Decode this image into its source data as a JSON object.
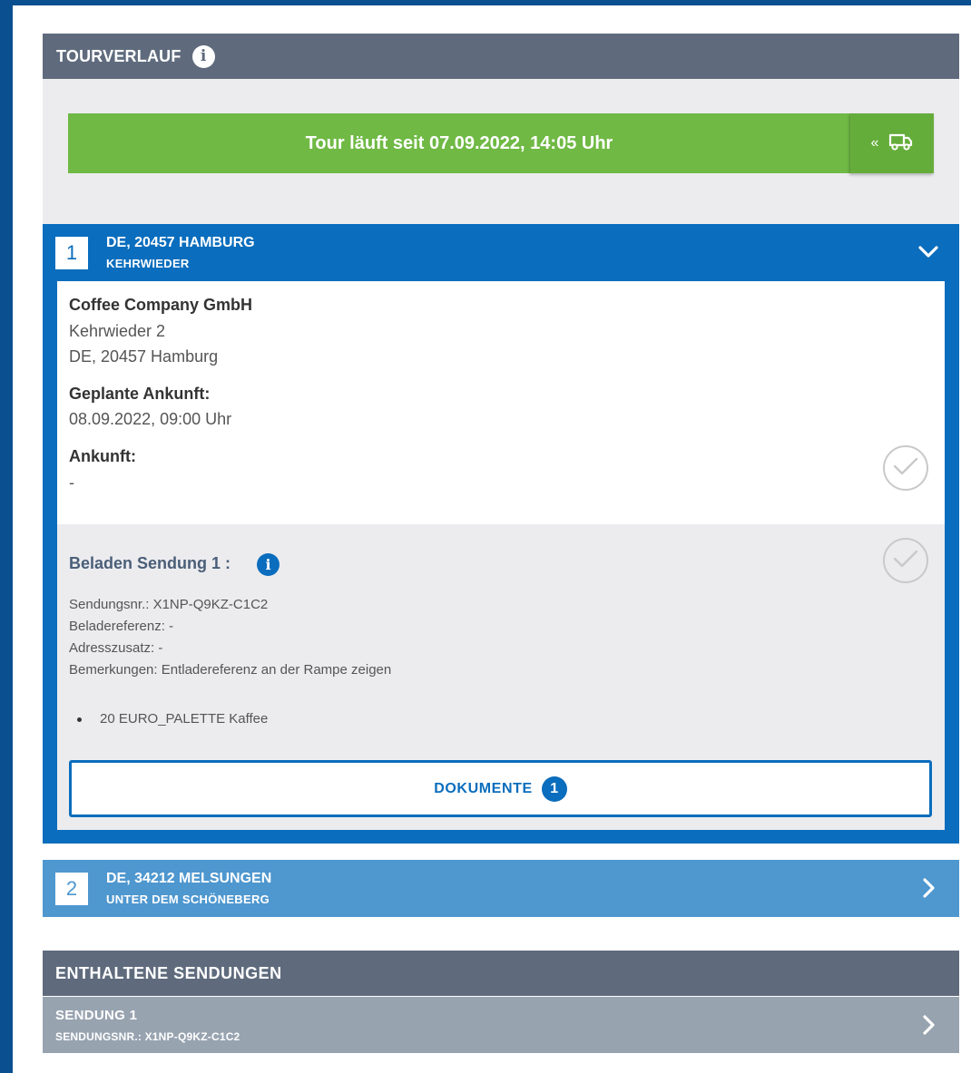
{
  "tour_panel": {
    "title": "TOURVERLAUF",
    "info_glyph": "i",
    "status_text": "Tour läuft seit 07.09.2022, 14:05 Uhr",
    "action_chevron": "«",
    "action_icon": "truck-icon"
  },
  "stops": [
    {
      "number": "1",
      "line1": "DE, 20457 HAMBURG",
      "line2": "KEHRWIEDER",
      "expanded": true,
      "company": "Coffee Company GmbH",
      "street": "Kehrwieder 2",
      "city": "DE, 20457 Hamburg",
      "planned_label": "Geplante Ankunft:",
      "planned_value": "08.09.2022, 09:00 Uhr",
      "arrival_label": "Ankunft:",
      "arrival_value": "-",
      "shipment": {
        "title": "Beladen Sendung 1 :",
        "info_glyph": "i",
        "details": [
          "Sendungsnr.: X1NP-Q9KZ-C1C2",
          "Beladereferenz: -",
          "Adresszusatz: -",
          "Bemerkungen: Entladereferenz an der Rampe zeigen"
        ],
        "items": [
          "20 EURO_PALETTE Kaffee"
        ],
        "documents_label": "DOKUMENTE",
        "documents_count": "1"
      }
    },
    {
      "number": "2",
      "line1": "DE, 34212 MELSUNGEN",
      "line2": "UNTER DEM SCHÖNEBERG",
      "expanded": false
    }
  ],
  "shipments_panel": {
    "title": "ENTHALTENE SENDUNGEN",
    "rows": [
      {
        "line1": "SENDUNG 1",
        "line2": "SENDUNGSNR.: X1NP-Q9KZ-C1C2"
      }
    ]
  },
  "colors": {
    "primary_blue": "#0a6dbd",
    "light_blue": "#4e97cf",
    "green": "#6fb944",
    "header_grey": "#5f6b7d",
    "row_grey": "#98a3b0"
  }
}
